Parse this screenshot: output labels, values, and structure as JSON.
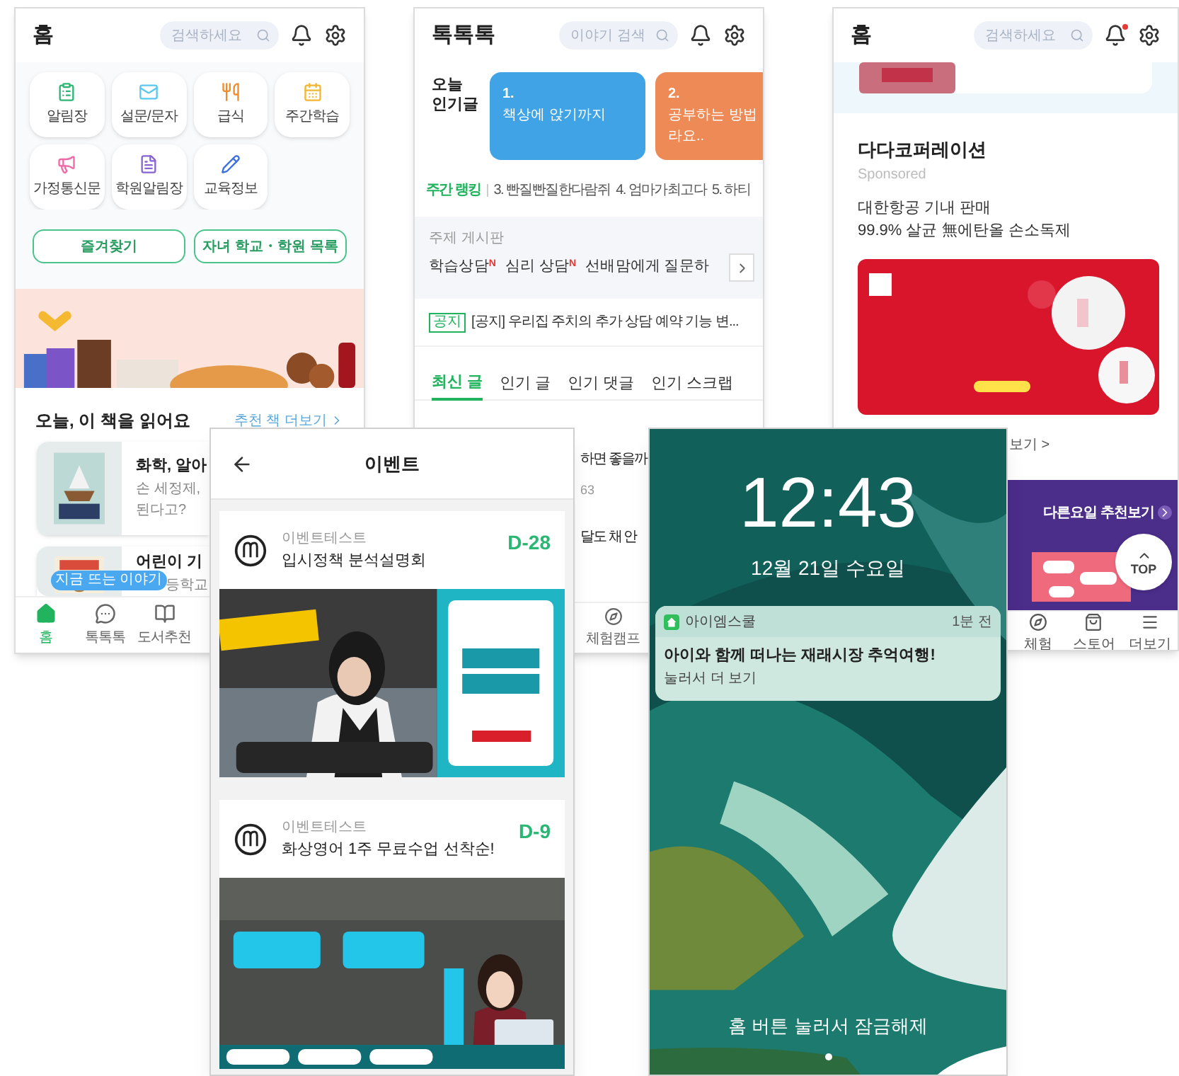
{
  "home_screen": {
    "title": "홈",
    "search": {
      "placeholder": "검색하세요"
    },
    "menu": [
      {
        "label": "알림장",
        "color": "#2bb673"
      },
      {
        "label": "설문/문자",
        "color": "#5bc8f0"
      },
      {
        "label": "급식",
        "color": "#f08c2a"
      },
      {
        "label": "주간학습",
        "color": "#f2b632"
      },
      {
        "label": "가정통신문",
        "color": "#f06aa8"
      },
      {
        "label": "학원알림장",
        "color": "#8a63d2"
      },
      {
        "label": "교육정보",
        "color": "#3b6fe0"
      }
    ],
    "buttons": [
      "즐겨찾기",
      "자녀 학교・학원 목록"
    ],
    "section": {
      "title": "오늘, 이 책을 읽어요",
      "link": "추천 책 더보기"
    },
    "books": [
      {
        "title": "화학, 알아",
        "lines": [
          "손 세정제,",
          "된다고?"
        ]
      },
      {
        "title": "어린이 기",
        "lines": [
          "등학교"
        ]
      }
    ],
    "tooltip": "지금 뜨는 이야기",
    "nav": [
      {
        "label": "홈",
        "selected": true
      },
      {
        "label": "톡톡톡",
        "selected": false
      },
      {
        "label": "도서추천",
        "selected": false
      }
    ]
  },
  "talk_screen": {
    "title": "톡톡톡",
    "search": {
      "placeholder": "이야기 검색"
    },
    "popular_label": "오늘 인기글",
    "popular": [
      {
        "number": "1.",
        "lines": [
          "책상에 앉기까지"
        ],
        "color": "#3fa3e6"
      },
      {
        "number": "2.",
        "lines": [
          "공부하는 방법",
          "라요.."
        ],
        "color": "#ee8a55"
      }
    ],
    "ranking": {
      "label": "주간 랭킹",
      "items": [
        "3. 빤질빤질한다람쥐",
        "4. 엄마가최고다",
        "5. 하티"
      ]
    },
    "boards": {
      "label": "주제 게시판",
      "items": [
        {
          "label": "학습상담",
          "badge": "N"
        },
        {
          "label": "심리 상담",
          "badge": "N"
        },
        {
          "label": "선배맘에게 질문하"
        }
      ]
    },
    "notice": {
      "badge": "공지",
      "text": "[공지] 우리집 주치의 추가 상담 예약 기능 변..."
    },
    "tabs": [
      {
        "label": "최신 글",
        "selected": true
      },
      {
        "label": "인기 글",
        "selected": false
      },
      {
        "label": "인기 댓글",
        "selected": false
      },
      {
        "label": "인기 스크랩",
        "selected": false
      }
    ],
    "posts": [
      {
        "title": "하면 좋을까",
        "meta": "63"
      },
      {
        "title": "달도 채 안"
      }
    ],
    "nav": [
      {
        "label": "체험캠프",
        "selected": false
      }
    ]
  },
  "right_screen": {
    "title": "홈",
    "search": {
      "placeholder": "검색하세요"
    },
    "unread": true,
    "advertiser": "다다코퍼레이션",
    "sponsored": "Sponsored",
    "ad_lines": [
      "대한항공 기내 판매",
      "99.9% 살균 無에탄올 손소독제"
    ],
    "more_link": "보기 >",
    "recommend": "다른요일 추천보기",
    "top_button": "TOP",
    "nav": [
      {
        "label": "체험",
        "selected": false
      },
      {
        "label": "스토어",
        "selected": false
      },
      {
        "label": "더보기",
        "selected": false
      }
    ]
  },
  "event_screen": {
    "title": "이벤트",
    "events": [
      {
        "organizer": "이벤트테스트",
        "title": "입시정책 분석설명회",
        "dday": "D-28"
      },
      {
        "organizer": "이벤트테스트",
        "title": "화상영어 1주 무료수업 선착순!",
        "dday": "D-9"
      }
    ]
  },
  "lock_screen": {
    "time": "12:43",
    "date": "12월 21일 수요일",
    "notification": {
      "app": "아이엠스쿨",
      "time": "1분 전",
      "title": "아이와 함께 떠나는 재래시장 추억여행!",
      "action": "눌러서 더 보기"
    },
    "unlock_hint": "홈 버튼 눌러서 잠금해제"
  }
}
